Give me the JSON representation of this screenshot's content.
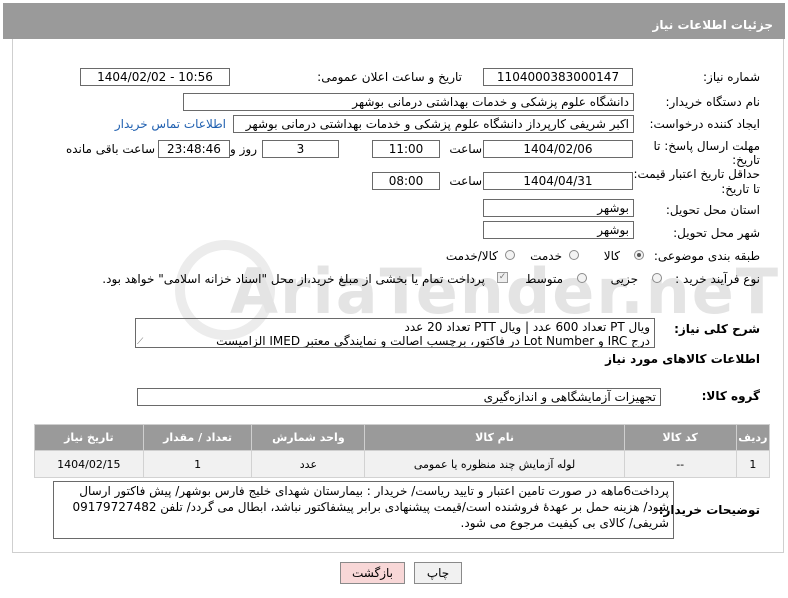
{
  "header": {
    "title": "جزئیات اطلاعات نیاز"
  },
  "watermark": {
    "text": "AriaTender.neT"
  },
  "fields": {
    "need_number_label": "شماره نیاز:",
    "need_number": "1104000383000147",
    "announce_label": "تاریخ و ساعت اعلان عمومی:",
    "announce_value": "1404/02/02 - 10:56",
    "buyer_org_label": "نام دستگاه خریدار:",
    "buyer_org": "دانشگاه علوم پزشکی و خدمات بهداشتی درمانی بوشهر",
    "creator_label": "ایجاد کننده درخواست:",
    "creator": "اکبر شریفی کارپرداز دانشگاه علوم پزشکی و خدمات بهداشتی درمانی بوشهر",
    "contact_link": "اطلاعات تماس خریدار",
    "deadline_label_1": "مهلت ارسال پاسخ: تا",
    "deadline_label_2": "تاریخ:",
    "deadline_date": "1404/02/06",
    "time_label": "ساعت",
    "deadline_time": "11:00",
    "days_value": "3",
    "days_label": "روز و",
    "remaining_value": "23:48:46",
    "remaining_label": "ساعت باقی مانده",
    "validity_label_1": "حداقل تاریخ اعتبار قیمت:",
    "validity_label_2": "تا تاریخ:",
    "validity_date": "1404/04/31",
    "validity_time": "08:00",
    "province_label": "استان محل تحویل:",
    "province": "بوشهر",
    "city_label": "شهر محل تحویل:",
    "city": "بوشهر",
    "category_label": "طبقه بندی موضوعی:",
    "category_options": [
      "کالا",
      "خدمت",
      "کالا/خدمت"
    ],
    "process_label": "نوع فرآیند خرید :",
    "process_options": [
      "جزیی",
      "متوسط"
    ],
    "payment_note": "پرداخت تمام یا بخشی از مبلغ خرید،از محل \"اسناد خزانه اسلامی\" خواهد بود.",
    "summary_label": "شرح کلی نیاز:",
    "summary_line1": "ویال PT تعداد 600 عدد | ویال PTT تعداد 20 عدد",
    "summary_line2": "درج IRC و Lot Number در فاکتور، برچسب اصالت و نمایندگی معتبر IMED الزامیست",
    "goods_info_title": "اطلاعات کالاهای مورد نیاز",
    "goods_group_label": "گروه کالا:",
    "goods_group": "تجهیزات آزمایشگاهی و اندازه‌گیری"
  },
  "table": {
    "headers": [
      "ردیف",
      "کد کالا",
      "نام کالا",
      "واحد شمارش",
      "تعداد / مقدار",
      "تاریخ نیاز"
    ],
    "rows": [
      [
        "1",
        "--",
        "لوله آزمایش چند منظوره یا عمومی",
        "عدد",
        "1",
        "1404/02/15"
      ]
    ]
  },
  "notes": {
    "label": "توضیحات خریدار:",
    "text": "پرداخت6ماهه در صورت تامین اعتبار و تایید ریاست/ خریدار : بیمارستان شهدای خلیج فارس بوشهر/ پیش فاکتور ارسال شود/ هزینه حمل بر عهدهٔ فروشنده است/قیمت پیشنهادی برابر پیشفاکتور نباشد، ابطال می گردد/ تلفن 09179727482 شریفی/ کالای بی کیفیت مرجوع می شود."
  },
  "buttons": {
    "print": "چاپ",
    "back": "بازگشت"
  },
  "colors": {
    "header_bg": "#9a9a9a",
    "link": "#2060b0",
    "back_button_bg": "#f8d7d7"
  }
}
